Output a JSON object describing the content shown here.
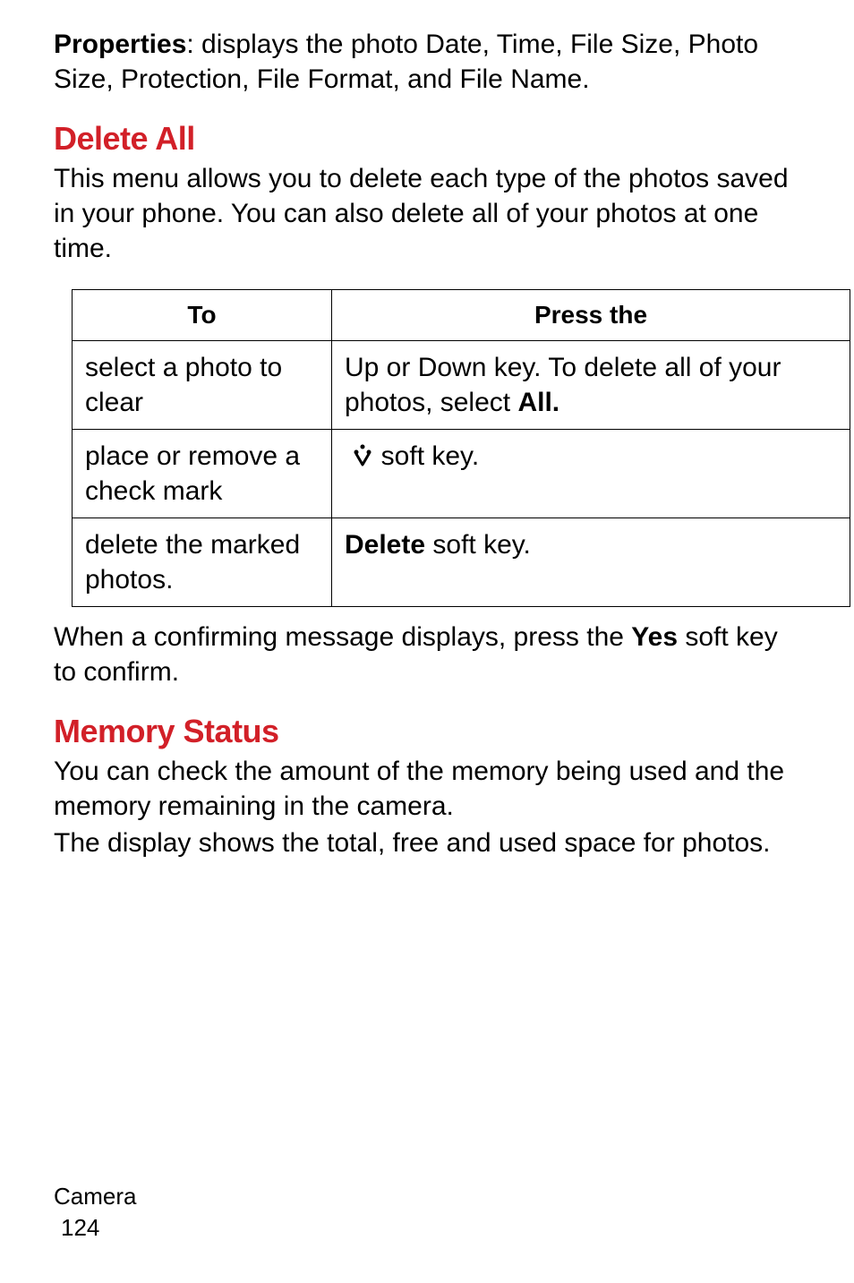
{
  "intro": {
    "properties_label": "Properties",
    "properties_rest": ": displays the photo Date, Time, File Size, Photo Size, Protection, File Format, and File Name."
  },
  "delete_all": {
    "heading": "Delete All",
    "para": "This menu allows you to delete each type of the photos saved in your phone. You can also delete all of your photos at one time.",
    "table": {
      "head_to": "To",
      "head_press": "Press the",
      "rows": [
        {
          "to": "select a photo to clear",
          "press_prefix": "Up or Down key. To delete all of your photos, select ",
          "press_bold": "All."
        },
        {
          "to": "place or remove a check mark",
          "press_icon": true,
          "press_suffix": " soft key."
        },
        {
          "to": "delete the marked photos.",
          "press_bold": "Delete",
          "press_suffix": " soft key."
        }
      ]
    },
    "after_prefix": "When a confirming message displays, press the ",
    "after_bold": "Yes",
    "after_suffix": " soft key to confirm."
  },
  "memory_status": {
    "heading": "Memory Status",
    "para1": "You can check the amount of the memory being used and the memory remaining in the camera.",
    "para2": "The display shows the total, free and used space for photos."
  },
  "footer": {
    "section": "Camera",
    "page": "124"
  }
}
